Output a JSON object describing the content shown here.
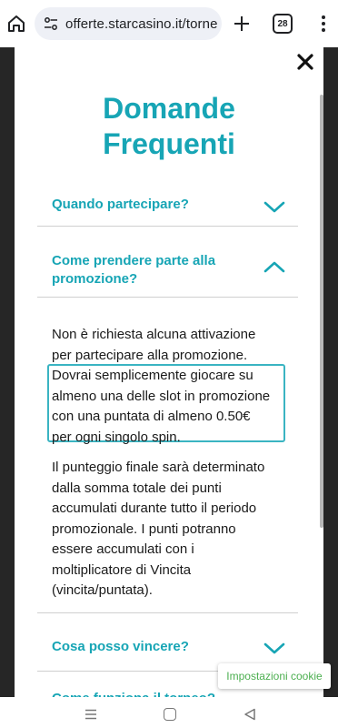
{
  "browser": {
    "url": "offerte.starcasino.it/torne",
    "tab_count": "28"
  },
  "modal": {
    "title_line1": "Domande",
    "title_line2": "Frequenti",
    "faq": [
      {
        "title": "Quando partecipare?",
        "expanded": false
      },
      {
        "title_line1": "Come prendere parte alla",
        "title_line2": "promozione?",
        "expanded": true
      },
      {
        "title": "Cosa posso vincere?",
        "expanded": false
      },
      {
        "title": "Come funziona il torneo?",
        "expanded": false
      }
    ],
    "answer": {
      "p1_lines": [
        "Non è richiesta alcuna attivazione",
        "per partecipare alla promozione."
      ],
      "p1_highlight_lines": [
        "Dovrai semplicemente giocare su",
        "almeno una delle slot in promozione",
        "con una puntata di almeno 0.50€",
        "per ogni singolo spin."
      ],
      "p2_lines": [
        "Il punteggio finale sarà determinato",
        "dalla somma totale dei punti",
        "accumulati durante tutto il periodo",
        "promozionale. I punti potranno",
        "essere accumulati con i",
        "moltiplicatore di Vincita",
        "(vincita/puntata)."
      ]
    }
  },
  "cookie_button_label": "Impostazioni cookie",
  "colors": {
    "accent": "#17a5b5",
    "highlight_border": "#3ab4c2",
    "cookie_text": "#4caf50"
  },
  "icons": [
    "home-icon",
    "site-info-icon",
    "new-tab-plus-icon",
    "tab-switcher-icon",
    "overflow-menu-icon",
    "close-icon",
    "chevron-down-icon",
    "chevron-up-icon",
    "recents-icon",
    "home-nav-icon",
    "back-icon"
  ]
}
